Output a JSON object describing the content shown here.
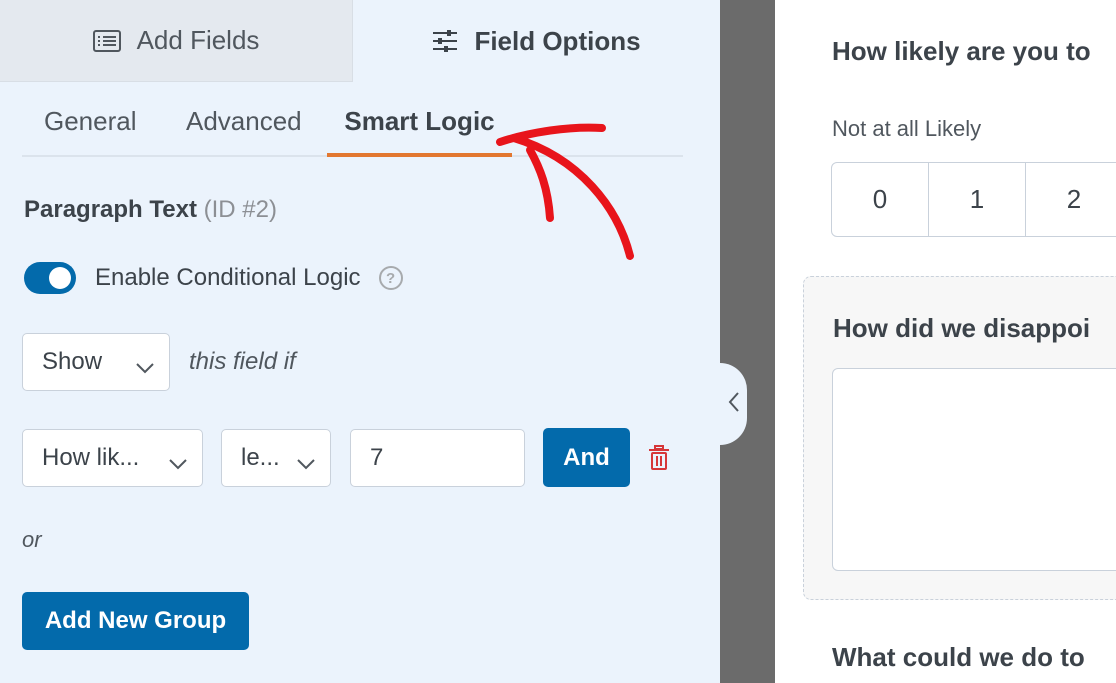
{
  "top_tabs": {
    "add_fields": "Add Fields",
    "field_options": "Field Options"
  },
  "sub_tabs": {
    "general": "General",
    "advanced": "Advanced",
    "smart_logic": "Smart Logic"
  },
  "field": {
    "name": "Paragraph Text",
    "id_label": "(ID #2)"
  },
  "conditional": {
    "toggle_label": "Enable Conditional Logic",
    "help_icon": "?",
    "action_value": "Show",
    "this_field_if": "this field if",
    "rule": {
      "field_value": "How lik...",
      "operator_value": "le...",
      "value": "7",
      "and_label": "And"
    },
    "or_label": "or",
    "add_group_label": "Add New Group"
  },
  "preview": {
    "question1": "How likely are you to",
    "scale_low_label": "Not at all Likely",
    "scale_values": [
      "0",
      "1",
      "2"
    ],
    "question2": "How did we disappoi",
    "question3": "What could we do to"
  },
  "colors": {
    "primary": "#036aab",
    "accent": "#e27730",
    "panel_bg": "#ebf3fc",
    "delete": "#d63638",
    "annotation_arrow": "#e8141b"
  }
}
